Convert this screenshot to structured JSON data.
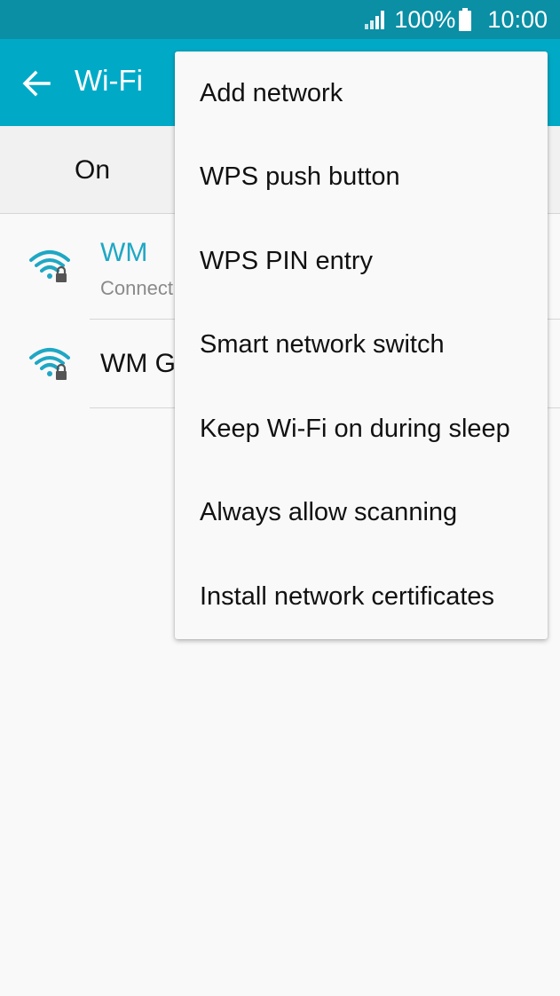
{
  "status_bar": {
    "battery": "100%",
    "time": "10:00",
    "icons": [
      "signal-icon",
      "battery-icon"
    ]
  },
  "app_bar": {
    "title": "Wi-Fi",
    "back_icon": "back-arrow-icon"
  },
  "master_switch": {
    "label": "On"
  },
  "networks": [
    {
      "name": "WM",
      "status": "Connect",
      "connected": true,
      "icon": "wifi-locked-icon"
    },
    {
      "name": "WM G",
      "status": "",
      "connected": false,
      "icon": "wifi-locked-icon"
    }
  ],
  "overflow_menu": {
    "items": [
      "Add network",
      "WPS push button",
      "WPS PIN entry",
      "Smart network switch",
      "Keep Wi-Fi on during sleep",
      "Always allow scanning",
      "Install network certificates"
    ]
  },
  "colors": {
    "status_bar": "#0a8fa5",
    "app_bar": "#00aac7",
    "accent": "#1fa7c4"
  }
}
